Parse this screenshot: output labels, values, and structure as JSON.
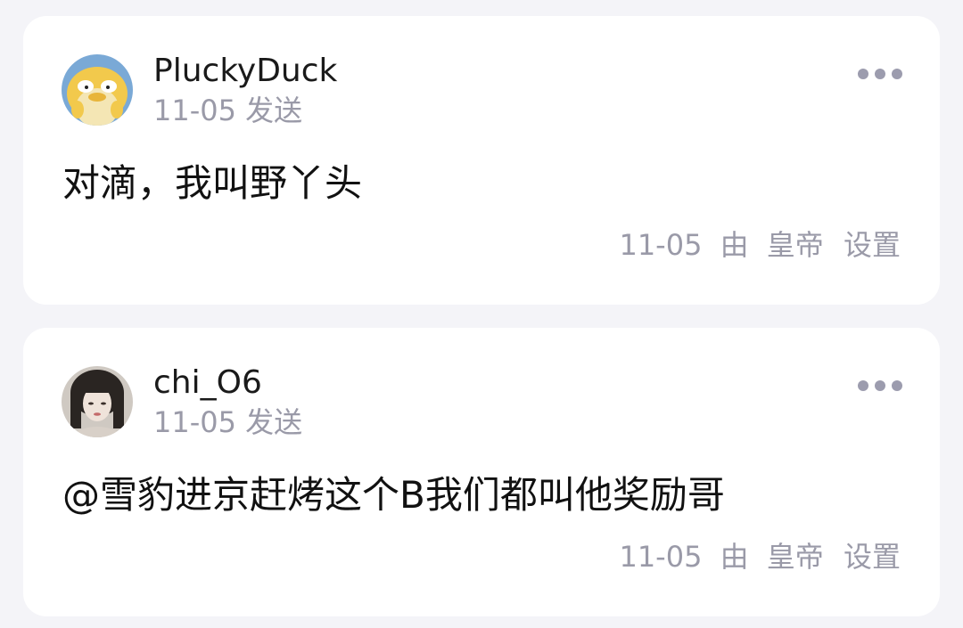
{
  "comments": [
    {
      "username": "PluckyDuck",
      "sent_time": "11-05 发送",
      "content": "对滴，我叫野丫头",
      "footer_date": "11-05",
      "footer_by": "由",
      "footer_role": "皇帝",
      "footer_action": "设置",
      "avatar_icon": "psyduck-avatar-icon",
      "more_icon": "more-dots-icon"
    },
    {
      "username": "chi_O6",
      "sent_time": "11-05 发送",
      "content": "@雪豹进京赶烤这个B我们都叫他奖励哥",
      "footer_date": "11-05",
      "footer_by": "由",
      "footer_role": "皇帝",
      "footer_action": "设置",
      "avatar_icon": "portrait-avatar-icon",
      "more_icon": "more-dots-icon"
    }
  ],
  "colors": {
    "background": "#f4f4f8",
    "card": "#ffffff",
    "primary_text": "#111111",
    "secondary_text": "#9a9aa8",
    "dots": "#9c9cae"
  }
}
